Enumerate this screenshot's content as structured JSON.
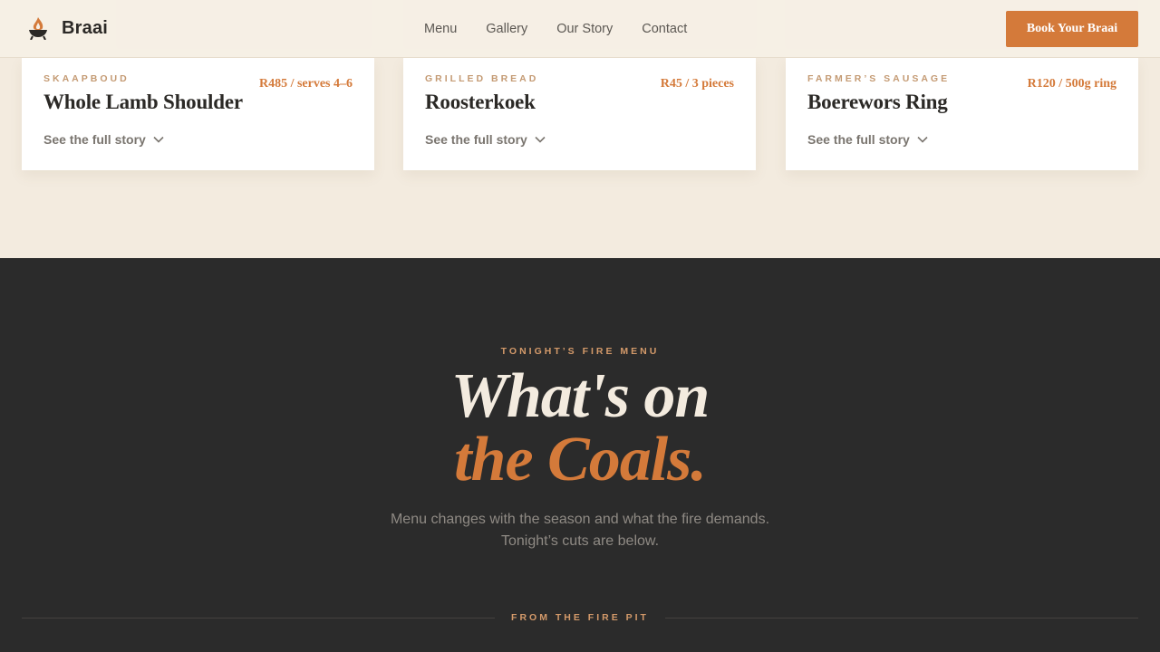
{
  "header": {
    "brand_name": "Braai",
    "brand_icon": "grill-flame-icon",
    "nav": [
      "Menu",
      "Gallery",
      "Our Story",
      "Contact"
    ],
    "cta_label": "Book Your Braai"
  },
  "cards": [
    {
      "eyebrow": "SKAAPBOUD",
      "title": "Whole Lamb Shoulder",
      "price": "R485 / serves 4–6",
      "story_label": "See the full story"
    },
    {
      "eyebrow": "GRILLED BREAD",
      "title": "Roosterkoek",
      "price": "R45 / 3 pieces",
      "story_label": "See the full story"
    },
    {
      "eyebrow": "FARMER’S SAUSAGE",
      "title": "Boerewors Ring",
      "price": "R120 / 500g ring",
      "story_label": "See the full story"
    }
  ],
  "section": {
    "kicker": "TONIGHT’S FIRE MENU",
    "headline_line1": "What's on",
    "headline_line2": "the Coals.",
    "subtitle_line1": "Menu changes with the season and what the fire demands.",
    "subtitle_line2": "Tonight’s cuts are below.",
    "divider_label": "FROM THE FIRE PIT"
  },
  "colors": {
    "accent": "#d47a3a",
    "cream_bg": "#f3ebdf",
    "dark_bg": "#2b2b2b",
    "eyebrow": "#c49a73",
    "text_dark": "#2b2926"
  }
}
